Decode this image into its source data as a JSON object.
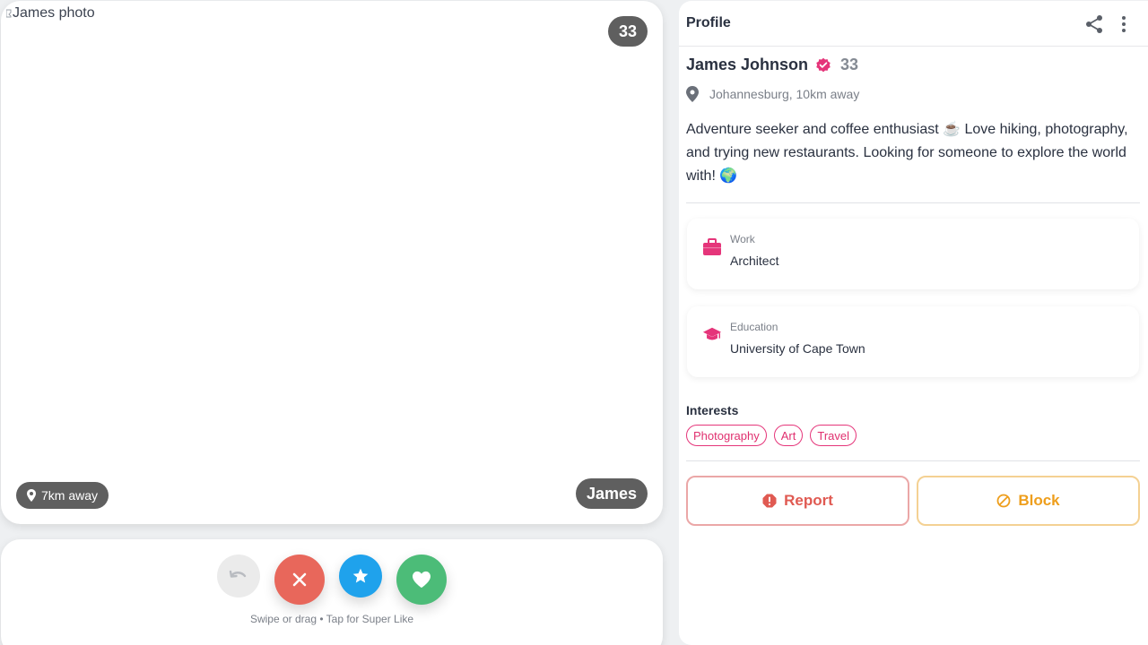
{
  "photo": {
    "alt_text": "James photo",
    "age_badge": "33",
    "distance_badge": "7km away",
    "name_badge": "James"
  },
  "actions": {
    "hint": "Swipe or drag • Tap for Super Like",
    "buttons": [
      "undo-icon",
      "close-icon",
      "star-icon",
      "heart-icon"
    ]
  },
  "profile": {
    "header_title": "Profile",
    "name": "James Johnson",
    "age": "33",
    "location": "Johannesburg, 10km away",
    "bio": "Adventure seeker and coffee enthusiast ☕ Love hiking, photography, and trying new restaurants. Looking for someone to explore the world with! 🌍",
    "work": {
      "label": "Work",
      "value": "Architect"
    },
    "education": {
      "label": "Education",
      "value": "University of Cape Town"
    },
    "interests_title": "Interests",
    "interests": [
      "Photography",
      "Art",
      "Travel"
    ],
    "report_label": "Report",
    "block_label": "Block"
  },
  "colors": {
    "accent": "#e5357a",
    "nope": "#e8675b",
    "superlike": "#1fa2ec",
    "like": "#4cbc78",
    "report": "#e05a52",
    "block": "#ee9e1c"
  }
}
